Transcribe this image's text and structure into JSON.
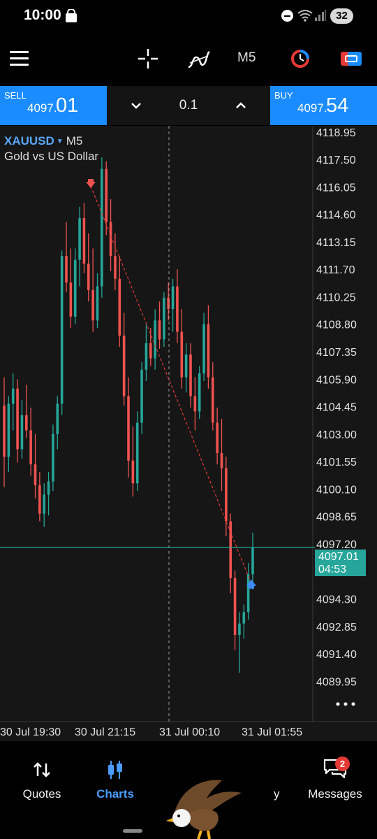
{
  "status_bar": {
    "time": "10:00",
    "battery": "32"
  },
  "toolbar": {
    "timeframe": "M5"
  },
  "trade_panel": {
    "sell_label": "SELL",
    "sell_price_main": "4097.",
    "sell_price_big": "01",
    "buy_label": "BUY",
    "buy_price_main": "4097.",
    "buy_price_big": "54",
    "lot": "0.1"
  },
  "chart": {
    "symbol": "XAUUSD",
    "timeframe": "M5",
    "description": "Gold vs US Dollar",
    "current_price": "4097.01",
    "bar_timer": "04:53",
    "colors": {
      "up": "#26a69a",
      "down": "#ef5350",
      "background": "#161616",
      "grid": "#3a3a3a",
      "bid_line": "#26a69a"
    }
  },
  "chart_data": {
    "type": "candlestick",
    "y_ticks": [
      "4118.95",
      "4117.50",
      "4116.05",
      "4114.60",
      "4113.15",
      "4111.70",
      "4110.25",
      "4108.80",
      "4107.35",
      "4105.90",
      "4104.45",
      "4103.00",
      "4101.55",
      "4100.10",
      "4098.65",
      "4097.20",
      "4095.75",
      "4094.30",
      "4092.85",
      "4091.40",
      "4089.95"
    ],
    "y_range": [
      4089.3,
      4119.2
    ],
    "x_ticks": [
      "30 Jul 19:30",
      "30 Jul 21:15",
      "31 Jul 00:10",
      "31 Jul 01:55"
    ],
    "current_price": 4097.01,
    "trade_line": {
      "from": {
        "time": "30 Jul 21:15",
        "price": 4116.1
      },
      "to": {
        "time": "31 Jul 01:55",
        "price": 4095.1
      }
    },
    "sell_marker": {
      "time": "30 Jul 21:15",
      "price": 4116.1
    },
    "buy_marker": {
      "time": "31 Jul 01:55",
      "price": 4095.1
    },
    "candles": [
      [
        4104.5,
        4106.0,
        4100.2,
        4101.8
      ],
      [
        4101.8,
        4105.0,
        4101.0,
        4104.6
      ],
      [
        4104.6,
        4106.2,
        4103.2,
        4105.4
      ],
      [
        4105.4,
        4105.9,
        4101.5,
        4102.2
      ],
      [
        4102.2,
        4104.8,
        4101.7,
        4104.0
      ],
      [
        4104.0,
        4105.6,
        4102.8,
        4103.2
      ],
      [
        4103.2,
        4104.4,
        4100.8,
        4101.4
      ],
      [
        4101.4,
        4103.0,
        4099.6,
        4100.3
      ],
      [
        4100.3,
        4101.0,
        4098.4,
        4098.8
      ],
      [
        4098.8,
        4100.4,
        4098.1,
        4099.8
      ],
      [
        4099.8,
        4101.0,
        4098.7,
        4100.5
      ],
      [
        4100.5,
        4103.5,
        4100.0,
        4103.0
      ],
      [
        4103.0,
        4105.0,
        4102.2,
        4104.6
      ],
      [
        4104.6,
        4112.7,
        4104.0,
        4112.4
      ],
      [
        4112.4,
        4114.2,
        4110.5,
        4111.0
      ],
      [
        4111.0,
        4112.8,
        4108.6,
        4109.2
      ],
      [
        4109.2,
        4112.8,
        4108.8,
        4112.2
      ],
      [
        4112.2,
        4115.0,
        4110.8,
        4114.4
      ],
      [
        4114.4,
        4115.2,
        4111.5,
        4112.0
      ],
      [
        4112.0,
        4113.6,
        4110.0,
        4110.6
      ],
      [
        4110.6,
        4112.8,
        4108.4,
        4109.0
      ],
      [
        4109.0,
        4111.5,
        4108.6,
        4110.8
      ],
      [
        4110.8,
        4117.6,
        4110.2,
        4117.0
      ],
      [
        4117.0,
        4117.4,
        4113.5,
        4114.2
      ],
      [
        4114.2,
        4115.4,
        4111.6,
        4112.4
      ],
      [
        4112.4,
        4113.6,
        4110.6,
        4111.2
      ],
      [
        4111.2,
        4112.4,
        4107.6,
        4108.2
      ],
      [
        4108.2,
        4109.4,
        4104.5,
        4105.0
      ],
      [
        4105.0,
        4106.0,
        4100.7,
        4101.6
      ],
      [
        4101.6,
        4103.4,
        4099.7,
        4100.4
      ],
      [
        4100.4,
        4104.2,
        4100.0,
        4103.6
      ],
      [
        4103.6,
        4106.8,
        4103.0,
        4106.4
      ],
      [
        4106.4,
        4108.8,
        4105.8,
        4107.8
      ],
      [
        4107.8,
        4108.6,
        4106.6,
        4107.0
      ],
      [
        4107.0,
        4109.6,
        4106.4,
        4109.0
      ],
      [
        4109.0,
        4110.0,
        4107.5,
        4108.0
      ],
      [
        4108.0,
        4110.5,
        4107.6,
        4110.2
      ],
      [
        4110.2,
        4111.0,
        4109.0,
        4109.6
      ],
      [
        4109.6,
        4111.2,
        4108.4,
        4110.8
      ],
      [
        4110.8,
        4111.7,
        4107.8,
        4108.4
      ],
      [
        4108.4,
        4109.6,
        4105.4,
        4106.0
      ],
      [
        4106.0,
        4107.8,
        4105.2,
        4107.2
      ],
      [
        4107.2,
        4107.8,
        4104.4,
        4105.0
      ],
      [
        4105.0,
        4106.0,
        4103.2,
        4104.2
      ],
      [
        4104.2,
        4106.6,
        4103.8,
        4106.2
      ],
      [
        4106.2,
        4109.4,
        4105.8,
        4108.8
      ],
      [
        4108.8,
        4109.8,
        4105.4,
        4106.0
      ],
      [
        4106.0,
        4106.8,
        4103.2,
        4103.6
      ],
      [
        4103.6,
        4104.4,
        4101.4,
        4102.0
      ],
      [
        4102.0,
        4103.8,
        4100.0,
        4101.2
      ],
      [
        4101.2,
        4101.8,
        4097.6,
        4098.4
      ],
      [
        4098.4,
        4098.8,
        4094.6,
        4095.4
      ],
      [
        4095.4,
        4095.8,
        4091.6,
        4092.4
      ],
      [
        4092.4,
        4093.6,
        4090.4,
        4093.0
      ],
      [
        4093.0,
        4094.0,
        4092.2,
        4093.6
      ],
      [
        4093.6,
        4096.2,
        4093.2,
        4095.6
      ],
      [
        4095.6,
        4097.8,
        4094.8,
        4097.01
      ]
    ]
  },
  "nav": {
    "quotes": "Quotes",
    "charts": "Charts",
    "history": "y",
    "messages": "Messages",
    "messages_badge": "2"
  }
}
